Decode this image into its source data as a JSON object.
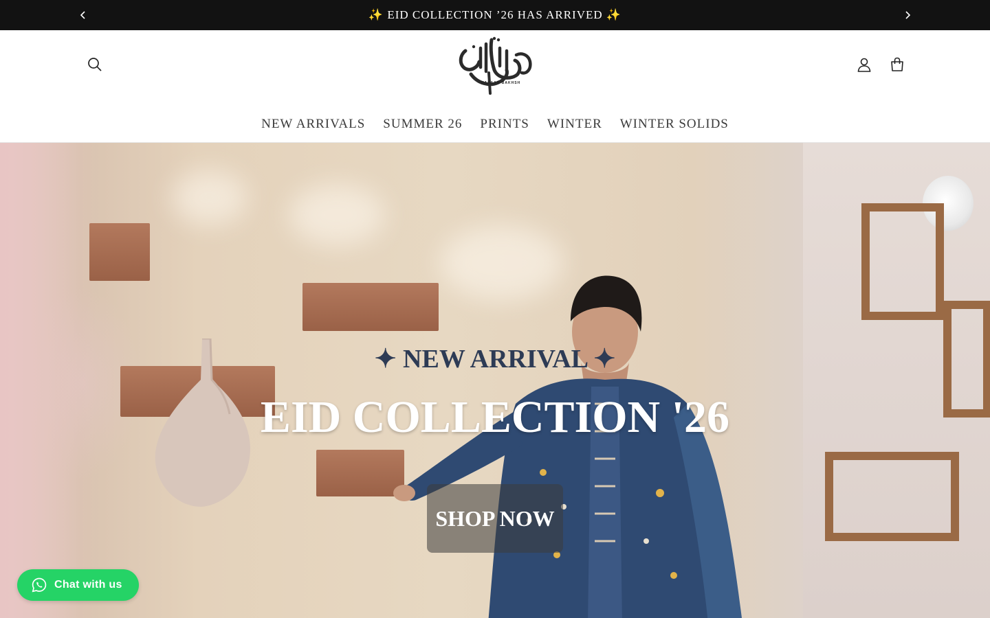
{
  "announcement": {
    "text": "✨ EID COLLECTION ’26 HAS ARRIVED ✨",
    "prev_icon": "chevron-left-icon",
    "next_icon": "chevron-right-icon"
  },
  "header": {
    "logo_subtext": "HASAAN BAKHSH",
    "icons": [
      "search-icon",
      "account-icon",
      "cart-icon"
    ]
  },
  "nav": {
    "items": [
      {
        "label": "NEW ARRIVALS"
      },
      {
        "label": "SUMMER 26"
      },
      {
        "label": "PRINTS"
      },
      {
        "label": "WINTER"
      },
      {
        "label": "WINTER SOLIDS"
      }
    ]
  },
  "hero": {
    "kicker": "✦ NEW ARRIVAL ✦",
    "title": "EID COLLECTION '26",
    "cta_label": "SHOP NOW"
  },
  "chat": {
    "label": "Chat with us",
    "color": "#25d366"
  }
}
